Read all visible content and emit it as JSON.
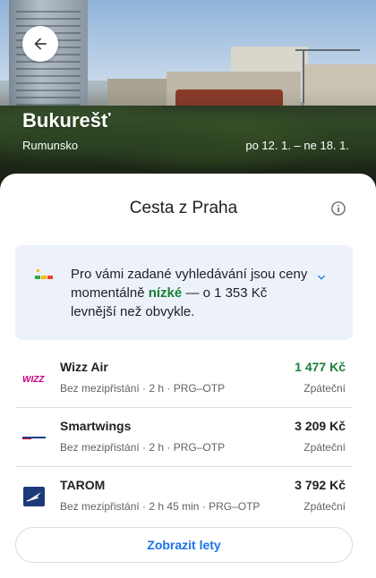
{
  "header": {
    "city": "Bukurešť",
    "country": "Rumunsko",
    "dates": "po 12. 1. – ne 18. 1."
  },
  "card": {
    "title": "Cesta z Praha"
  },
  "notice": {
    "line_before": "Pro vámi zadané vyhledávání jsou ceny momentálně ",
    "highlight": "nízké",
    "line_after": " — o 1 353 Kč levnější než obvykle.",
    "highlight_color": "#188038"
  },
  "flights": [
    {
      "airline": "Wizz Air",
      "stops": "Bez mezipřistání",
      "duration": "2 h",
      "route": "PRG–OTP",
      "price": "1 477 Kč",
      "trip": "Zpáteční",
      "logo_icon": "wizzair-logo-icon",
      "cheapest": true
    },
    {
      "airline": "Smartwings",
      "stops": "Bez mezipřistání",
      "duration": "2 h",
      "route": "PRG–OTP",
      "price": "3 209 Kč",
      "trip": "Zpáteční",
      "logo_icon": "smartwings-logo-icon",
      "cheapest": false
    },
    {
      "airline": "TAROM",
      "stops": "Bez mezipřistání",
      "duration": "2 h 45 min",
      "route": "PRG–OTP",
      "price": "3 792 Kč",
      "trip": "Zpáteční",
      "logo_icon": "tarom-logo-icon",
      "cheapest": false
    }
  ],
  "actions": {
    "show_flights": "Zobrazit lety"
  },
  "colors": {
    "accent": "#1a73e8",
    "cheap_price": "#188038",
    "notice_bg": "#edf2fa"
  }
}
